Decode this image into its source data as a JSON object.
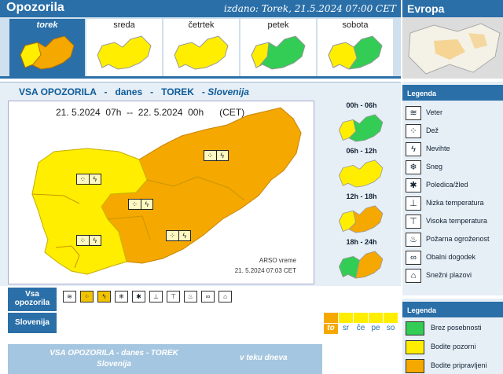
{
  "header": {
    "title": "Opozorila",
    "issued": "izdano: Torek, 21.5.2024 07:00 CET",
    "europe_title": "Evropa"
  },
  "days": [
    {
      "label": "torek",
      "selected": true,
      "level": "pripravljeni"
    },
    {
      "label": "sreda",
      "selected": false,
      "level": "pozorni"
    },
    {
      "label": "četrtek",
      "selected": false,
      "level": "pozorni"
    },
    {
      "label": "petek",
      "selected": false,
      "level": "mixed"
    },
    {
      "label": "sobota",
      "selected": false,
      "level": "mixed"
    }
  ],
  "section": {
    "title_a": "VSA OPOZORILA   -   danes   -   TOREK   -",
    "title_region": "Slovenija"
  },
  "main_map": {
    "valid": "21. 5.2024  07h  --  22. 5.2024  00h      (CET)",
    "credit_1": "ARSO vreme",
    "credit_2": "21. 5.2024  07:03 CET"
  },
  "time_slots": [
    {
      "label": "00h - 06h"
    },
    {
      "label": "06h - 12h"
    },
    {
      "label": "12h - 18h"
    },
    {
      "label": "18h - 24h"
    }
  ],
  "legend_title": "Legenda",
  "legend": [
    {
      "icon": "wind-icon",
      "glyph": "≋",
      "label": "Veter"
    },
    {
      "icon": "rain-icon",
      "glyph": "⁘",
      "label": "Dež"
    },
    {
      "icon": "thunderstorm-icon",
      "glyph": "ϟ",
      "label": "Nevihte"
    },
    {
      "icon": "snow-icon",
      "glyph": "❄",
      "label": "Sneg"
    },
    {
      "icon": "ice-icon",
      "glyph": "✱",
      "label": "Poledica/žled"
    },
    {
      "icon": "low-temperature-icon",
      "glyph": "⊥",
      "label": "Nizka temperatura"
    },
    {
      "icon": "high-temperature-icon",
      "glyph": "⊤",
      "label": "Visoka temperatura"
    },
    {
      "icon": "fire-danger-icon",
      "glyph": "♨",
      "label": "Požarna ogroženost"
    },
    {
      "icon": "coastal-event-icon",
      "glyph": "∞",
      "label": "Obalni dogodek"
    },
    {
      "icon": "avalanche-icon",
      "glyph": "⌂",
      "label": "Snežni plazovi"
    }
  ],
  "legend2_title": "Legenda",
  "levels": [
    {
      "label": "Brez posebnosti",
      "color": "#33cc55"
    },
    {
      "label": "Bodite pozorni",
      "color": "#ffee00"
    },
    {
      "label": "Bodite pripravljeni",
      "color": "#f5a800"
    }
  ],
  "filters": {
    "all_label": "Vsa opozorila",
    "region_label": "Slovenija"
  },
  "week_tabs": [
    "to",
    "sr",
    "če",
    "pe",
    "so"
  ],
  "footer": {
    "line1": "VSA OPOZORILA - danes - TOREK",
    "line2": "Slovenija",
    "right": "v teku dneva"
  }
}
